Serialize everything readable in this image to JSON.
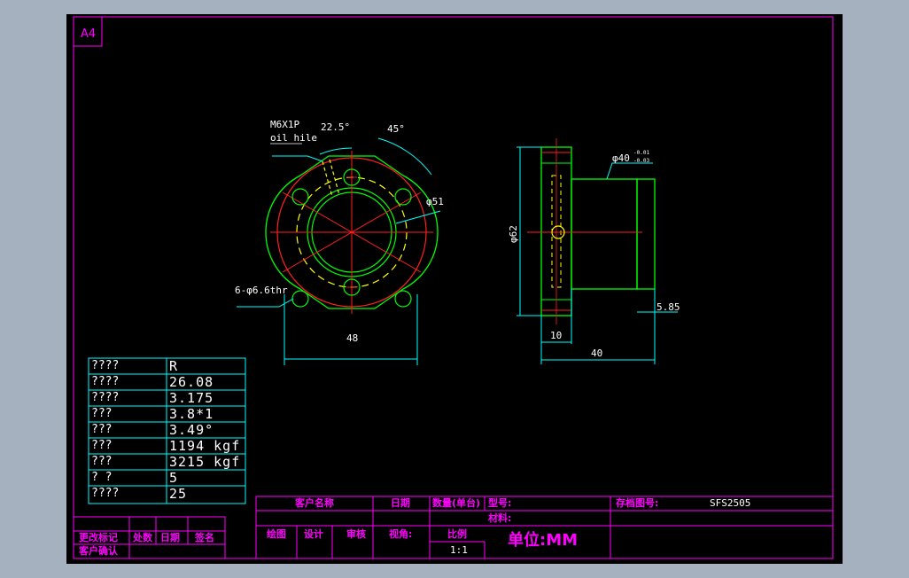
{
  "sheet": {
    "size_label": "A4"
  },
  "front_view": {
    "thread_label": "M6X1P",
    "oil_label": "oil hile",
    "angle_small": "22.5°",
    "angle_large": "45°",
    "pcd_label": "φ51",
    "holes_label": "6-φ6.6thr",
    "width_dim": "48"
  },
  "side_view": {
    "pilot_dia": "φ40",
    "pilot_tol_upper": "-0.01",
    "pilot_tol_lower": "-0.03",
    "flange_dia": "φ62",
    "flange_thk": "10",
    "length": "40",
    "end_dim": "5.85"
  },
  "params": [
    {
      "name": "????",
      "value": "R"
    },
    {
      "name": "????",
      "value": "26.08"
    },
    {
      "name": "????",
      "value": "3.175"
    },
    {
      "name": " ???",
      "value": "3.8*1"
    },
    {
      "name": " ???",
      "value": "3.49°"
    },
    {
      "name": " ???",
      "value": "1194 kgf"
    },
    {
      "name": " ???",
      "value": "3215 kgf"
    },
    {
      "name": " ?  ?",
      "value": "5"
    },
    {
      "name": "????",
      "value": "25"
    }
  ],
  "revision_block": {
    "change_mark": "更改标记",
    "locations": "处数",
    "date": "日期",
    "sign": "签名",
    "customer_confirm": "客户确认"
  },
  "title_block": {
    "customer_name": "客户名称",
    "date": "日期",
    "qty": "数量(单台)",
    "model": "型号:",
    "drawing_no_label": "存档图号:",
    "drawing_no": "SFS2505",
    "material": "材料:",
    "drawn": "绘图",
    "design": "设计",
    "check": "审核",
    "view_angle": "视角:",
    "scale_label": "比例",
    "scale": "1:1",
    "unit": "单位:MM"
  }
}
